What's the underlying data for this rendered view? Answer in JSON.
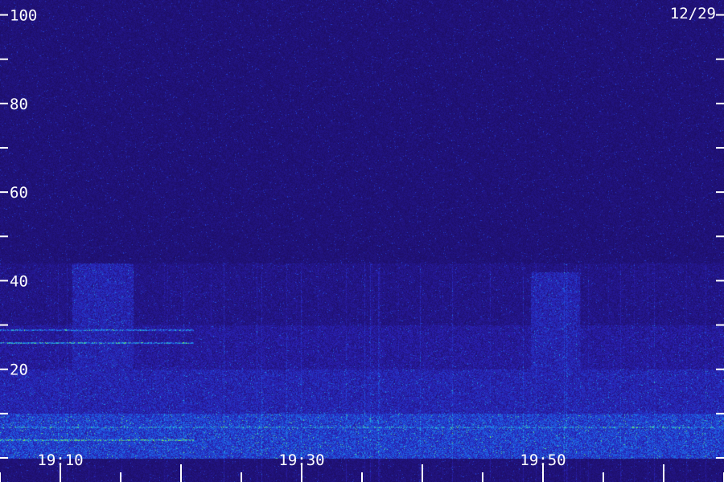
{
  "chart_data": {
    "type": "heatmap",
    "title": "",
    "xlabel": "",
    "ylabel": "",
    "date_label": "12/29",
    "y_tick_labels": [
      "20",
      "40",
      "60",
      "80",
      "100"
    ],
    "y_ticks": [
      0,
      10,
      20,
      30,
      40,
      50,
      60,
      70,
      80,
      90,
      100
    ],
    "ylim": [
      0,
      103
    ],
    "x_tick_labels": [
      "19:10",
      "19:30",
      "19:50"
    ],
    "xlim": [
      "19:05",
      "20:05"
    ],
    "x_minor_step_min": 5,
    "colormap": [
      "#1a0a55",
      "#2a1fb0",
      "#1f4fe0",
      "#1fa8e6",
      "#7fe84a"
    ],
    "features": [
      {
        "kind": "noise_floor",
        "from": 0,
        "to": 103,
        "level": 0.12
      },
      {
        "kind": "band",
        "from": 0,
        "to": 10,
        "intensity": 0.85
      },
      {
        "kind": "band",
        "from": 10,
        "to": 20,
        "intensity": 0.55
      },
      {
        "kind": "band",
        "from": 20,
        "to": 30,
        "intensity": 0.4
      },
      {
        "kind": "band",
        "from": 30,
        "to": 44,
        "intensity": 0.28
      },
      {
        "kind": "line",
        "at": 4,
        "x_from": "19:05",
        "x_to": "19:21",
        "intensity": 1.0
      },
      {
        "kind": "line",
        "at": 7,
        "x_from": "19:05",
        "x_to": "20:05",
        "intensity": 0.8
      },
      {
        "kind": "line",
        "at": 26,
        "x_from": "19:05",
        "x_to": "19:21",
        "intensity": 0.85
      },
      {
        "kind": "line",
        "at": 29,
        "x_from": "19:05",
        "x_to": "19:21",
        "intensity": 0.75
      },
      {
        "kind": "burst",
        "x_from": "19:11",
        "x_to": "19:16",
        "y_to": 44,
        "intensity": 0.55
      },
      {
        "kind": "burst",
        "x_from": "19:19",
        "x_to": "19:23",
        "y_to": 40,
        "intensity": 0.3
      },
      {
        "kind": "burst",
        "x_from": "19:49",
        "x_to": "19:53",
        "y_to": 42,
        "intensity": 0.55
      }
    ]
  }
}
